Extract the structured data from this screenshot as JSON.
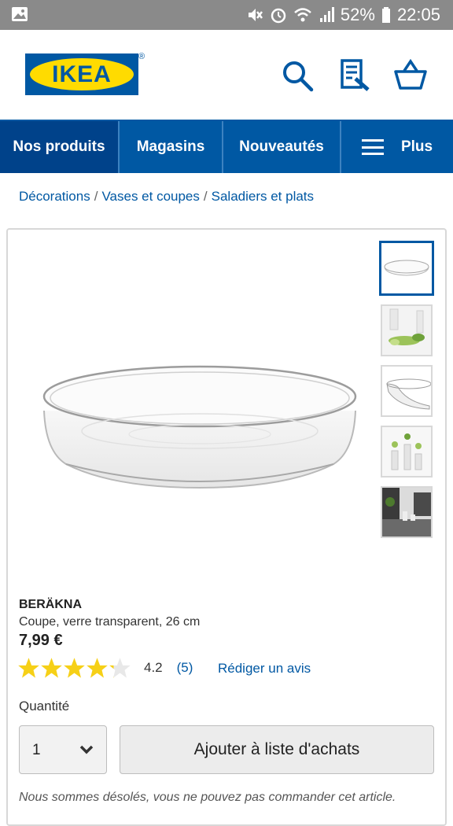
{
  "status_bar": {
    "battery": "52%",
    "time": "22:05",
    "icons": [
      "image-icon",
      "mute-icon",
      "alarm-icon",
      "wifi-icon",
      "signal-icon",
      "battery-icon"
    ]
  },
  "header": {
    "logo_text": "IKEA",
    "logo_registered": "®",
    "icons": [
      "search-icon",
      "shopping-list-icon",
      "basket-icon"
    ],
    "colors": {
      "brand_blue": "#0058a3",
      "brand_yellow": "#ffdb00"
    }
  },
  "nav": {
    "items": [
      {
        "label": "Nos produits"
      },
      {
        "label": "Magasins"
      },
      {
        "label": "Nouveautés"
      },
      {
        "label": "Plus"
      }
    ]
  },
  "breadcrumb": {
    "items": [
      "Décorations",
      "Vases et coupes",
      "Saladiers et plats"
    ],
    "separator": "/"
  },
  "product": {
    "name": "BERÄKNA",
    "description": "Coupe, verre transparent, 26 cm",
    "price": "7,99 €",
    "rating_value": "4.2",
    "rating_count": "(5)",
    "stars_filled": 4.2,
    "stars_total": 5,
    "review_link": "Rédiger un avis",
    "thumbnails": [
      "bowl-thumbnail",
      "bowl-with-plants-thumbnail",
      "bowl-side-thumbnail",
      "vases-thumbnail",
      "room-thumbnail"
    ],
    "selected_thumbnail": 0
  },
  "purchase": {
    "quantity_label": "Quantité",
    "quantity_value": "1",
    "add_button": "Ajouter à liste d'achats",
    "notice": "Nous sommes désolés, vous ne pouvez pas commander cet article."
  }
}
